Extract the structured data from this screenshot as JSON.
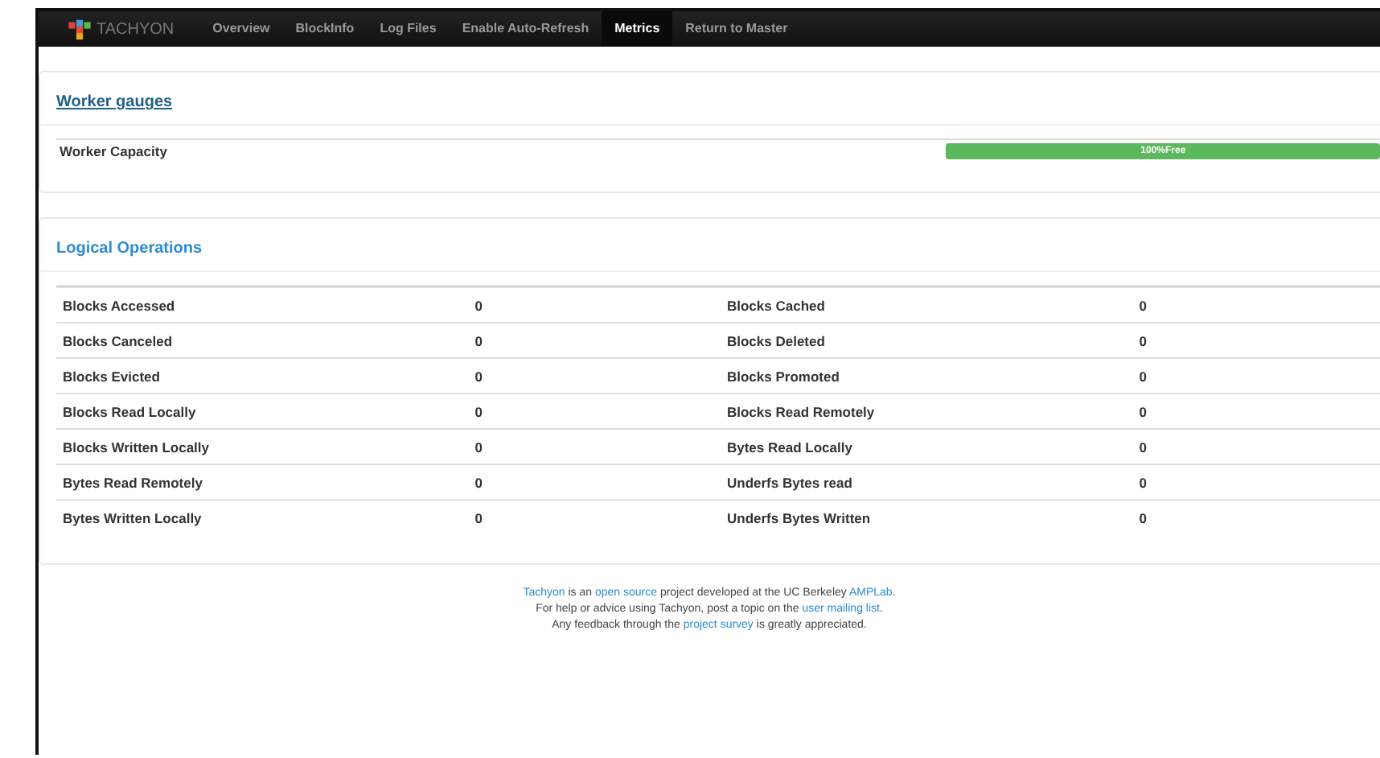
{
  "navbar": {
    "brand": "TACHYON",
    "items": [
      {
        "label": "Overview",
        "selected": false
      },
      {
        "label": "BlockInfo",
        "selected": false
      },
      {
        "label": "Log Files",
        "selected": false
      },
      {
        "label": "Enable Auto-Refresh",
        "selected": false
      },
      {
        "label": "Metrics",
        "selected": true
      },
      {
        "label": "Return to Master",
        "selected": false
      }
    ]
  },
  "worker_gauges": {
    "title": "Worker gauges",
    "rows": [
      {
        "label": "Worker Capacity",
        "level": 1,
        "reading": "100%Free"
      }
    ]
  },
  "logical_operations": {
    "title": "Logical Operations",
    "rows": [
      [
        {
          "name": "Blocks Accessed",
          "value": "0"
        },
        {
          "name": "Blocks Cached",
          "value": "0"
        }
      ],
      [
        {
          "name": "Blocks Canceled",
          "value": "0"
        },
        {
          "name": "Blocks Deleted",
          "value": "0"
        }
      ],
      [
        {
          "name": "Blocks Evicted",
          "value": "0"
        },
        {
          "name": "Blocks Promoted",
          "value": "0"
        }
      ],
      [
        {
          "name": "Blocks Read Locally",
          "value": "0"
        },
        {
          "name": "Blocks Read Remotely",
          "value": "0"
        }
      ],
      [
        {
          "name": "Blocks Written Locally",
          "value": "0"
        },
        {
          "name": "Bytes Read Locally",
          "value": "0"
        }
      ],
      [
        {
          "name": "Bytes Read Remotely",
          "value": "0"
        },
        {
          "name": "Underfs Bytes read",
          "value": "0"
        }
      ],
      [
        {
          "name": "Bytes Written Locally",
          "value": "0"
        },
        {
          "name": "Underfs Bytes Written",
          "value": "0"
        }
      ]
    ]
  },
  "footer": [
    [
      {
        "text": "Tachyon",
        "link": true
      },
      {
        "text": " is an ",
        "link": false
      },
      {
        "text": "open source",
        "link": true
      },
      {
        "text": " project developed at the UC Berkeley ",
        "link": false
      },
      {
        "text": "AMPLab",
        "link": true
      },
      {
        "text": ".",
        "link": false
      }
    ],
    [
      {
        "text": "For help or advice using Tachyon, post a topic on the ",
        "link": false
      },
      {
        "text": "user mailing list",
        "link": true
      },
      {
        "text": ".",
        "link": false
      }
    ],
    [
      {
        "text": "Any feedback through the ",
        "link": false
      },
      {
        "text": "project survey",
        "link": true
      },
      {
        "text": " is greatly appreciated.",
        "link": false
      }
    ]
  ]
}
